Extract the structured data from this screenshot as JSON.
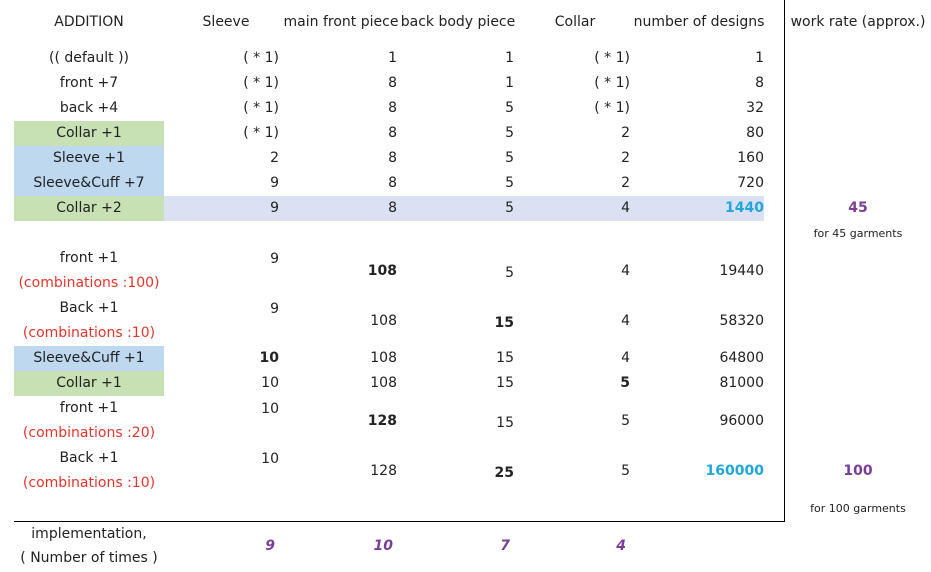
{
  "headers": [
    "ADDITION",
    "Sleeve",
    "main front piece",
    "back body piece",
    "Collar",
    "number of designs",
    "work rate (approx.)"
  ],
  "rows": [
    {
      "addition": "(( default ))",
      "sleeve": "( * 1)",
      "front": "1",
      "back": "1",
      "collar": "( * 1)",
      "designs": "1",
      "bg": ""
    },
    {
      "addition": "front +7",
      "sleeve": "( * 1)",
      "front": "8",
      "back": "1",
      "collar": "( * 1)",
      "designs": "8",
      "bg": ""
    },
    {
      "addition": "back +4",
      "sleeve": "( * 1)",
      "front": "8",
      "back": "5",
      "collar": "( * 1)",
      "designs": "32",
      "bg": ""
    },
    {
      "addition": "Collar +1",
      "sleeve": "( * 1)",
      "front": "8",
      "back": "5",
      "collar": "2",
      "designs": "80",
      "bg": "green"
    },
    {
      "addition": "Sleeve +1",
      "sleeve": "2",
      "front": "8",
      "back": "5",
      "collar": "2",
      "designs": "160",
      "bg": "blue"
    },
    {
      "addition": "Sleeve&Cuff  +7",
      "sleeve": "9",
      "front": "8",
      "back": "5",
      "collar": "2",
      "designs": "720",
      "bg": "blue"
    },
    {
      "addition": "Collar +2",
      "sleeve": "9",
      "front": "8",
      "back": "5",
      "collar": "4",
      "designs": "1440",
      "bg": "green",
      "highlight": true,
      "work_rate": "45",
      "work_note": "for 45 garments"
    }
  ],
  "rows2": [
    {
      "addition": "front +1",
      "addition_note": "(combinations :100)",
      "sleeve": "9",
      "front": "108",
      "back": "5",
      "collar": "4",
      "designs": "19440",
      "bold": "front"
    },
    {
      "addition": "Back +1",
      "addition_note": "(combinations :10)",
      "sleeve": "9",
      "front": "108",
      "back": "15",
      "collar": "4",
      "designs": "58320",
      "bold": "back"
    },
    {
      "addition": "Sleeve&Cuff  +1",
      "sleeve": "10",
      "front": "108",
      "back": "15",
      "collar": "4",
      "designs": "64800",
      "bold": "sleeve",
      "bg": "blue"
    },
    {
      "addition": "Collar +1",
      "sleeve": "10",
      "front": "108",
      "back": "15",
      "collar": "5",
      "designs": "81000",
      "bold": "collar",
      "bg": "green"
    },
    {
      "addition": "front +1",
      "addition_note": "(combinations :20)",
      "sleeve": "10",
      "front": "128",
      "back": "15",
      "collar": "5",
      "designs": "96000",
      "bold": "front"
    },
    {
      "addition": "Back +1",
      "addition_note": "(combinations :10)",
      "sleeve": "10",
      "front": "128",
      "back": "25",
      "collar": "5",
      "designs": "160000",
      "bold": "back",
      "work_rate": "100",
      "work_note": "for 100 garments"
    }
  ],
  "footer": {
    "label_line1": "implementation,",
    "label_line2": "( Number of times )",
    "sleeve": "9",
    "front": "10",
    "back": "7",
    "collar": "4"
  },
  "colors": {
    "green": "#c7e1b4",
    "blue": "#bed8ef",
    "lavender": "#dbe1f3",
    "red": "#e5352b",
    "cyan": "#21a7dd",
    "purple": "#7a3d98"
  }
}
